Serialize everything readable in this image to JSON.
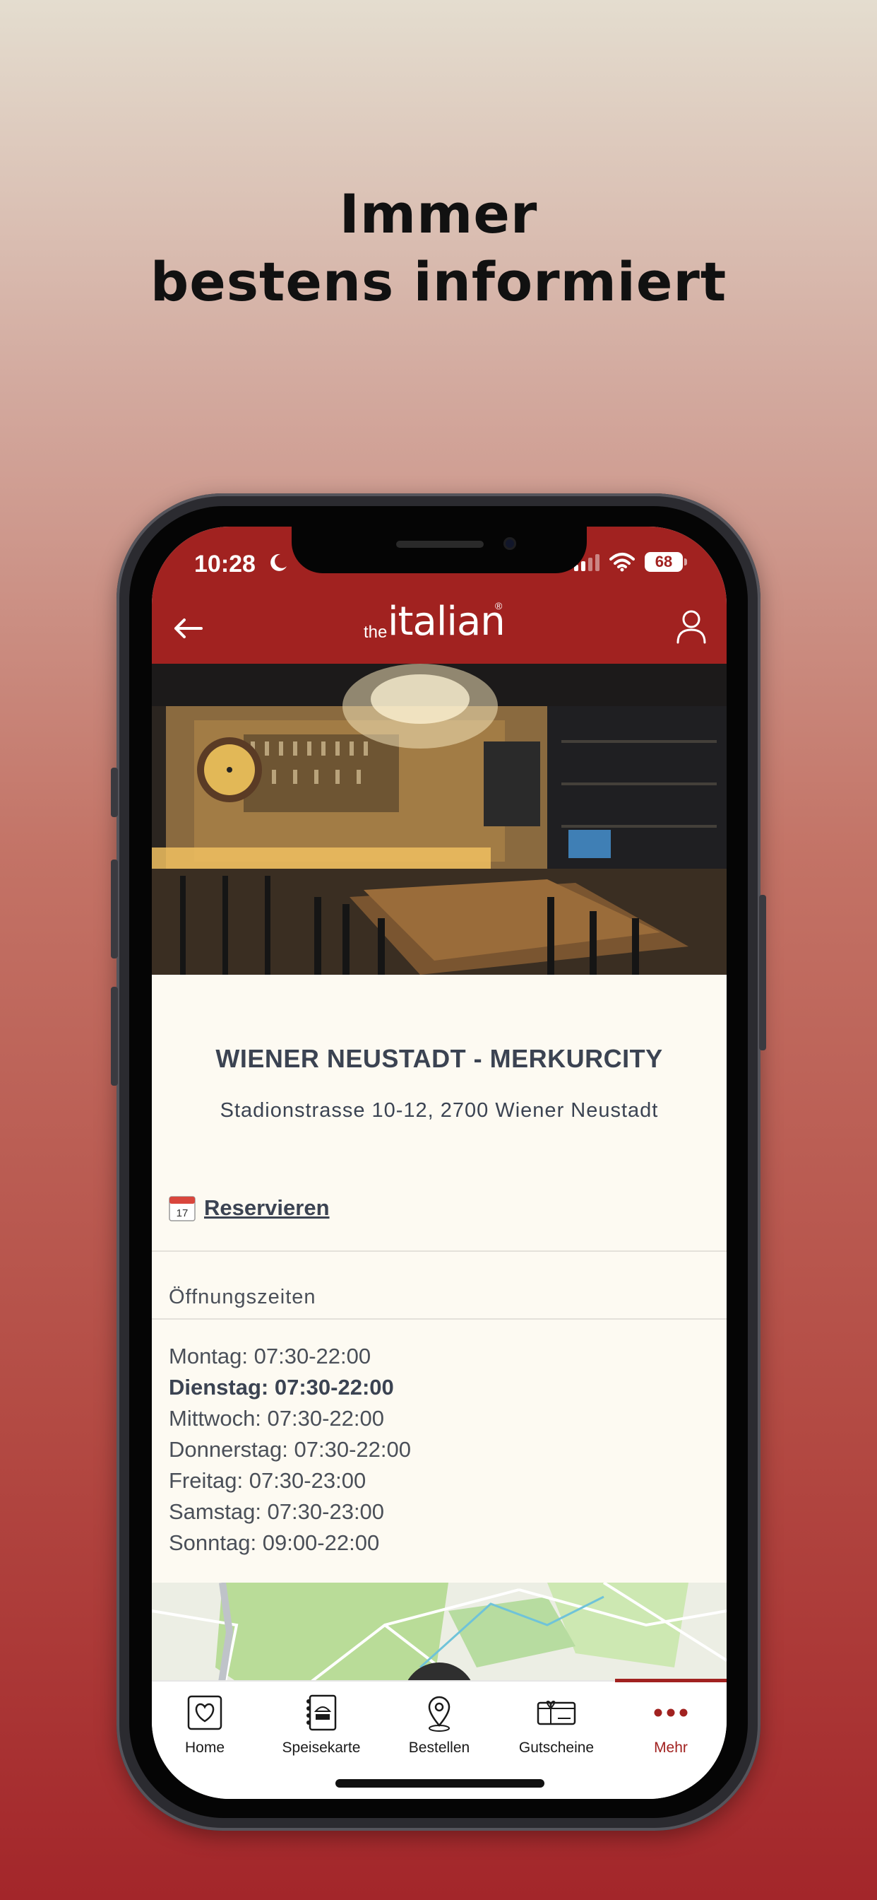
{
  "headline": {
    "line1": "Immer",
    "line2": "bestens informiert"
  },
  "status_bar": {
    "time": "10:28",
    "battery": "68"
  },
  "header": {
    "logo_prefix": "the",
    "logo_name": "italian",
    "logo_reg": "®"
  },
  "venue": {
    "name": "WIENER NEUSTADT - MERKURCITY",
    "address": "Stadionstrasse 10-12, 2700 Wiener Neustadt",
    "reserve_label": "Reservieren",
    "calendar_day": "17"
  },
  "hours": {
    "heading": "Öffnungszeiten",
    "days": [
      "Montag: 07:30-22:00",
      "Dienstag: 07:30-22:00",
      "Mittwoch: 07:30-22:00",
      "Donnerstag: 07:30-22:00",
      "Freitag: 07:30-23:00",
      "Samstag: 07:30-23:00",
      "Sonntag: 09:00-22:00"
    ],
    "highlighted_day_index": 1
  },
  "tabbar": {
    "items": [
      {
        "label": "Home",
        "icon": "heart-icon"
      },
      {
        "label": "Speisekarte",
        "icon": "menu-book-icon"
      },
      {
        "label": "Bestellen",
        "icon": "location-pin-icon"
      },
      {
        "label": "Gutscheine",
        "icon": "gift-card-icon"
      },
      {
        "label": "Mehr",
        "icon": "more-dots-icon",
        "active": true
      }
    ]
  },
  "colors": {
    "brand_red": "#a12220",
    "text_dark": "#3b4352",
    "content_bg": "#fdfaf2"
  }
}
